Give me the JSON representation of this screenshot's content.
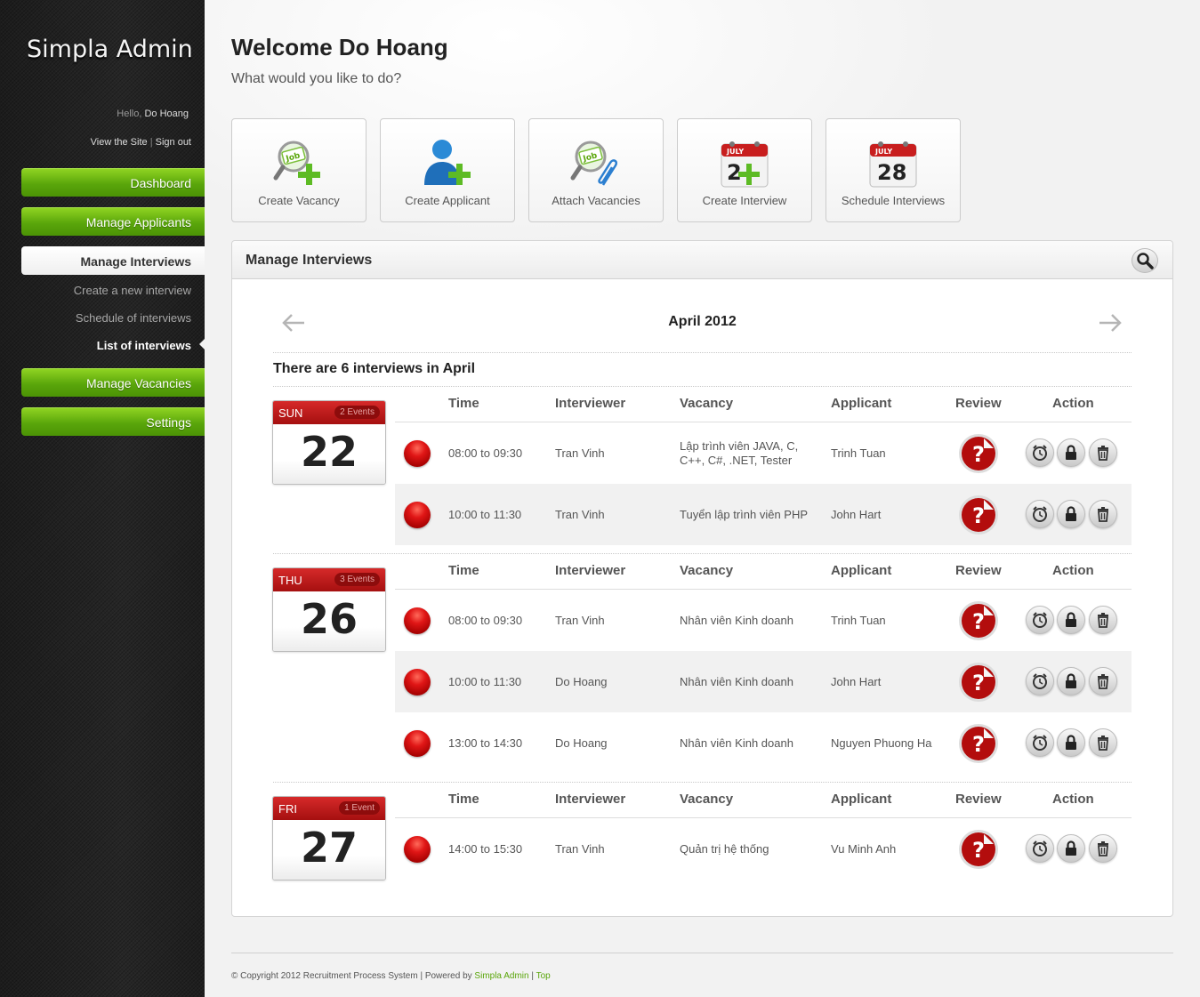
{
  "sidebar": {
    "logo": "Simpla Admin",
    "hello_prefix": "Hello,",
    "user_name": "Do Hoang",
    "view_site": "View the Site",
    "separator": "|",
    "sign_out": "Sign out",
    "nav": {
      "dashboard": "Dashboard",
      "manage_applicants": "Manage Applicants",
      "manage_interviews": "Manage Interviews",
      "manage_vacancies": "Manage Vacancies",
      "settings": "Settings"
    },
    "sub": {
      "create": "Create a new interview",
      "schedule": "Schedule of interviews",
      "list": "List of interviews"
    }
  },
  "header": {
    "welcome": "Welcome Do Hoang",
    "prompt": "What would you like to do?"
  },
  "shortcuts": [
    {
      "label": "Create Vacancy",
      "icon": "job-search-add-icon"
    },
    {
      "label": "Create Applicant",
      "icon": "user-add-icon"
    },
    {
      "label": "Attach Vacancies",
      "icon": "job-attach-icon"
    },
    {
      "label": "Create Interview",
      "icon": "calendar-add-icon"
    },
    {
      "label": "Schedule Interviews",
      "icon": "calendar-icon"
    }
  ],
  "calendar_icon": {
    "month": "JULY",
    "day": "28",
    "day_partial": "2"
  },
  "panel": {
    "title": "Manage Interviews",
    "month": "April 2012",
    "summary": "There are 6 interviews in April",
    "columns": {
      "time": "Time",
      "interviewer": "Interviewer",
      "vacancy": "Vacancy",
      "applicant": "Applicant",
      "review": "Review",
      "action": "Action"
    },
    "days": [
      {
        "dow": "SUN",
        "day": "22",
        "events": "2 Events",
        "rows": [
          {
            "time": "08:00 to 09:30",
            "interviewer": "Tran Vinh",
            "vacancy": "Lập trình viên JAVA, C, C++, C#, .NET, Tester",
            "applicant": "Trinh Tuan"
          },
          {
            "time": "10:00 to 11:30",
            "interviewer": "Tran Vinh",
            "vacancy": "Tuyển lập trình viên PHP",
            "applicant": "John Hart"
          }
        ]
      },
      {
        "dow": "THU",
        "day": "26",
        "events": "3 Events",
        "rows": [
          {
            "time": "08:00 to 09:30",
            "interviewer": "Tran Vinh",
            "vacancy": "Nhân viên Kinh doanh",
            "applicant": "Trinh Tuan"
          },
          {
            "time": "10:00 to 11:30",
            "interviewer": "Do Hoang",
            "vacancy": "Nhân viên Kinh doanh",
            "applicant": "John Hart"
          },
          {
            "time": "13:00 to 14:30",
            "interviewer": "Do Hoang",
            "vacancy": "Nhân viên Kinh doanh",
            "applicant": "Nguyen Phuong Ha"
          }
        ]
      },
      {
        "dow": "FRI",
        "day": "27",
        "events": "1 Event",
        "rows": [
          {
            "time": "14:00 to 15:30",
            "interviewer": "Tran Vinh",
            "vacancy": "Quản trị hệ thống",
            "applicant": "Vu Minh Anh"
          }
        ]
      }
    ]
  },
  "footer": {
    "copyright": "© Copyright 2012 Recruitment Process System | Powered by",
    "powered_link": "Simpla Admin",
    "separator": "|",
    "top_link": "Top"
  },
  "colors": {
    "accent_green": "#5aa60b",
    "calendar_red": "#c01818",
    "status_red": "#e01616"
  }
}
